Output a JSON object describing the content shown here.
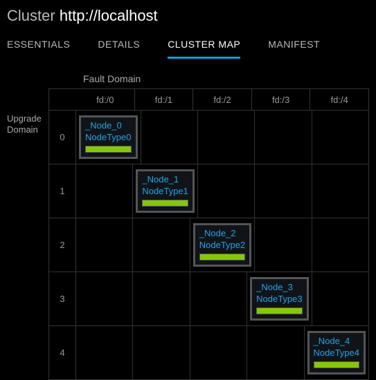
{
  "header": {
    "label": "Cluster",
    "url": "http://localhost"
  },
  "tabs": [
    {
      "id": "essentials",
      "label": "ESSENTIALS",
      "active": false
    },
    {
      "id": "details",
      "label": "DETAILS",
      "active": false
    },
    {
      "id": "clustermap",
      "label": "CLUSTER MAP",
      "active": true
    },
    {
      "id": "manifest",
      "label": "MANIFEST",
      "active": false
    }
  ],
  "cluster_map": {
    "fault_domain_label": "Fault Domain",
    "upgrade_domain_label": "Upgrade Domain",
    "fault_domains": [
      "fd:/0",
      "fd:/1",
      "fd:/2",
      "fd:/3",
      "fd:/4"
    ],
    "upgrade_domains": [
      "0",
      "1",
      "2",
      "3",
      "4"
    ],
    "nodes": [
      {
        "ud": 0,
        "fd": 0,
        "name": "_Node_0",
        "type": "NodeType0",
        "health": "ok"
      },
      {
        "ud": 1,
        "fd": 1,
        "name": "_Node_1",
        "type": "NodeType1",
        "health": "ok"
      },
      {
        "ud": 2,
        "fd": 2,
        "name": "_Node_2",
        "type": "NodeType2",
        "health": "ok"
      },
      {
        "ud": 3,
        "fd": 3,
        "name": "_Node_3",
        "type": "NodeType3",
        "health": "ok"
      },
      {
        "ud": 4,
        "fd": 4,
        "name": "_Node_4",
        "type": "NodeType4",
        "health": "ok"
      }
    ],
    "health_color": "#85c808",
    "link_color": "#22a4e6"
  }
}
